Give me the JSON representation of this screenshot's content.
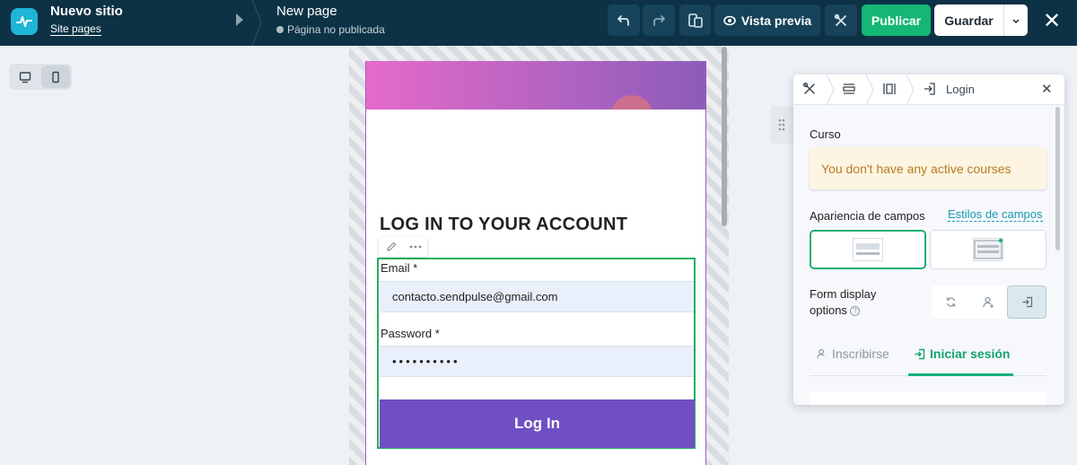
{
  "topbar": {
    "site_title": "Nuevo sitio",
    "site_pages": "Site pages",
    "page_title": "New page",
    "page_status": "Página no publicada",
    "preview_label": "Vista previa",
    "publish_label": "Publicar",
    "save_label": "Guardar",
    "close_label": "✕"
  },
  "canvas": {
    "heading": "LOG IN TO YOUR ACCOUNT",
    "email_label": "Email *",
    "email_value": "contacto.sendpulse@gmail.com",
    "password_label": "Password *",
    "password_value": "••••••••••",
    "login_button": "Log In"
  },
  "panel": {
    "breadcrumb_label": "Login",
    "course_label": "Curso",
    "course_alert": "You don't have any active courses",
    "fields_appearance_label": "Apariencia de campos",
    "fields_styles_link": "Estilos de campos",
    "form_display_label_1": "Form display",
    "form_display_label_2": "options",
    "tab_subscribe": "Inscribirse",
    "tab_login": "Iniciar sesión"
  },
  "colors": {
    "topbar_bg": "#0d3245",
    "publish": "#14b774",
    "login_button": "#6f4fc3",
    "selection_border": "#23b05f",
    "alert_text": "#b77a23"
  }
}
